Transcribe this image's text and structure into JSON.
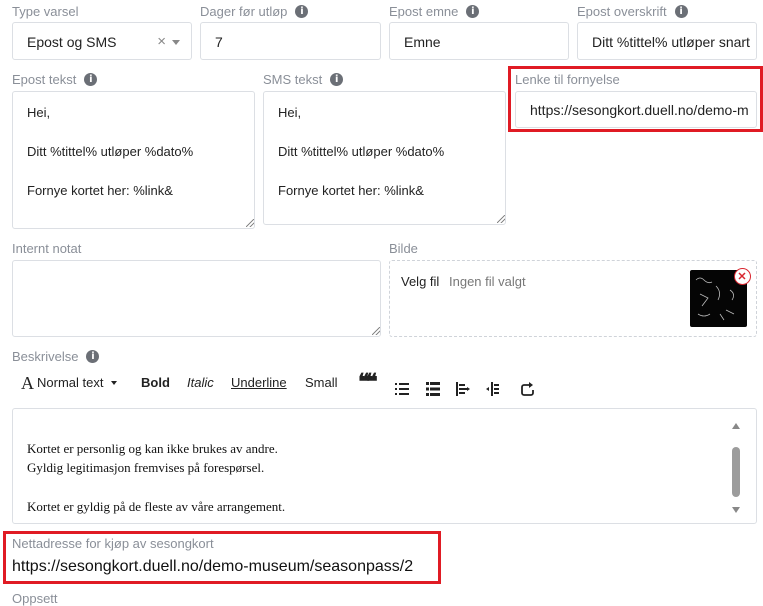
{
  "fields": {
    "type_label": "Type varsel",
    "type_value": "Epost og SMS",
    "type_clear": "×",
    "days_label": "Dager før utløp",
    "days_value": "7",
    "subject_label": "Epost emne",
    "subject_value": "Emne",
    "heading_label": "Epost overskrift",
    "heading_value": "Ditt %tittel% utløper snart",
    "email_text_label": "Epost tekst",
    "email_text_value": "Hei,\n\nDitt %tittel% utløper %dato%\n\nFornye kortet her: %link&",
    "sms_text_label": "SMS tekst",
    "sms_text_value": "Hei,\n\nDitt %tittel% utløper %dato%\n\nFornye kortet her: %link&",
    "renew_link_label": "Lenke til fornyelse",
    "renew_link_value": "https://sesongkort.duell.no/demo-m",
    "internal_note_label": "Internt notat",
    "internal_note_value": "",
    "image_label": "Bilde",
    "file_button": "Velg fil",
    "file_status": "Ingen fil valgt",
    "description_label": "Beskrivelse"
  },
  "toolbar": {
    "font_icon": "A",
    "text_style": "Normal text",
    "bold": "Bold",
    "italic": "Italic",
    "underline": "Underline",
    "small": "Small",
    "quote": "❝❝"
  },
  "editor": {
    "lines": [
      "Kortet er personlig og kan ikke brukes av andre.",
      "Gyldig legitimasjon fremvises på forespørsel.",
      "Kortet er gyldig på de fleste av våre arrangement."
    ]
  },
  "purchase": {
    "label": "Nettadresse for kjøp av sesongkort",
    "url": "https://sesongkort.duell.no/demo-museum/seasonpass/2"
  },
  "setup_label": "Oppsett",
  "colors": {
    "highlight": "#e01b24",
    "border": "#dcdfe4",
    "label": "#8a8f98"
  },
  "icons": [
    "info-icon",
    "clear-icon",
    "chevron-down-icon",
    "remove-image-icon",
    "bulleted-list-icon",
    "numbered-list-icon",
    "indent-icon",
    "outdent-icon",
    "redo-icon",
    "scroll-up-icon",
    "scroll-down-icon"
  ]
}
